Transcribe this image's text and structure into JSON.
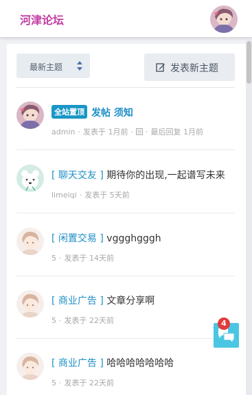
{
  "header": {
    "logo_text": "河津论坛",
    "user_avatar_icon": "user-avatar-anime-icon"
  },
  "toolbar": {
    "sort_label": "最新主题",
    "new_topic_label": "发表新主题"
  },
  "threads": [
    {
      "badge": "全站置顶",
      "tag": "",
      "title": "发帖 须知",
      "author": "admin",
      "posted": "发表于 1月前",
      "last_reply": "最后回复 1月前"
    },
    {
      "badge": "",
      "tag": "[ 聊天交友 ]",
      "title": "期待你的出现,一起谱写未来",
      "author": "limeiqi",
      "posted": "发表于 5天前",
      "last_reply": ""
    },
    {
      "badge": "",
      "tag": "[ 闲置交易 ]",
      "title": "vggghgggh",
      "author": "5",
      "posted": "发表于 14天前",
      "last_reply": ""
    },
    {
      "badge": "",
      "tag": "[ 商业广告 ]",
      "title": "文章分享啊",
      "author": "5",
      "posted": "发表于 22天前",
      "last_reply": ""
    },
    {
      "badge": "",
      "tag": "[ 商业广告 ]",
      "title": "哈哈哈哈哈哈哈",
      "author": "5",
      "posted": "发表于 22天前",
      "last_reply": ""
    }
  ],
  "chat": {
    "unread_count": "4"
  },
  "colors": {
    "brand": "#c13aa1",
    "link": "#1e8fc6",
    "badge": "#1997c6",
    "chat": "#4bc6e2",
    "alert": "#e33b3b"
  }
}
